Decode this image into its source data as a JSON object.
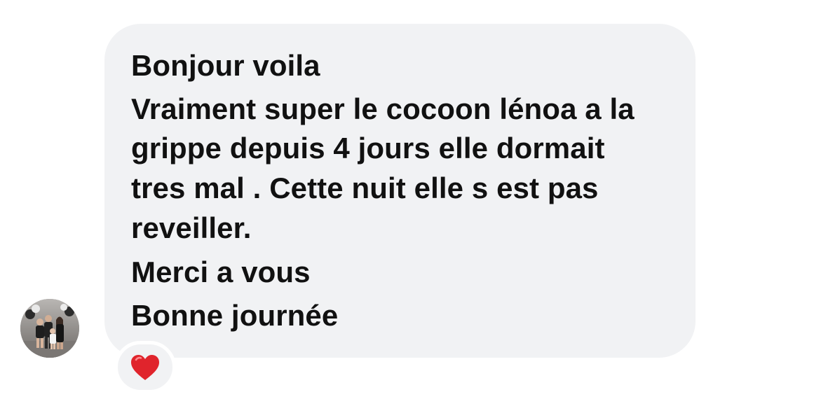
{
  "message": {
    "lines": [
      "Bonjour voila",
      "Vraiment super le cocoon lénoa a la",
      "grippe depuis 4 jours elle dormait",
      "tres mal . Cette nuit elle s est pas",
      "reveiller.",
      "Merci a vous",
      "Bonne journée"
    ]
  },
  "sender": {
    "avatar_icon": "family-photo-avatar"
  },
  "reaction": {
    "icon": "red-heart-icon",
    "color": "#e0242c"
  },
  "colors": {
    "bubble_background": "#f1f2f4",
    "text": "#111111"
  }
}
